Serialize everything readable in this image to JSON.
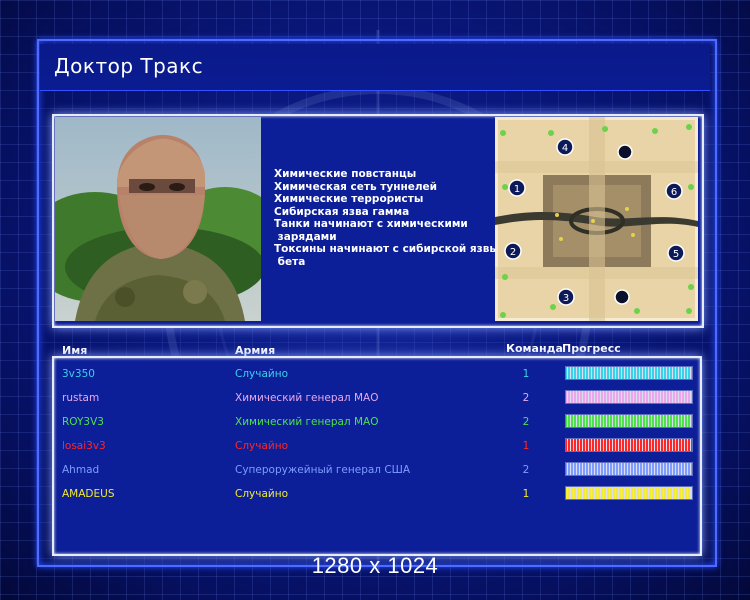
{
  "title": "Доктор Тракс",
  "description_lines": [
    "Химические повстанцы",
    "Химическая сеть туннелей",
    "Химические террористы",
    "Сибирская язва гамма",
    "Танки начинают с химическими",
    " зарядами",
    "Токсины начинают с сибирской язвы",
    " бета"
  ],
  "columns": {
    "player": "Имя игрока",
    "army": "Армия",
    "team": "Команда",
    "progress": "Прогресс"
  },
  "players": [
    {
      "name": "3v350",
      "army": "Случайно",
      "team": "1",
      "color": "#3ad2e8",
      "progress": 1.0
    },
    {
      "name": "rustam",
      "army": "Химический генерал МАО",
      "team": "2",
      "color": "#e8a8ea",
      "progress": 1.0
    },
    {
      "name": "ROY3V3",
      "army": "Химический генерал МАО",
      "team": "2",
      "color": "#4ee24a",
      "progress": 1.0
    },
    {
      "name": "losai3v3",
      "army": "Случайно",
      "team": "1",
      "color": "#ff2626",
      "progress": 1.0
    },
    {
      "name": "Ahmad",
      "army": "Супероружейный генерал США",
      "team": "2",
      "color": "#7f9cff",
      "progress": 1.0
    },
    {
      "name": "AMADEUS",
      "army": "Случайно",
      "team": "1",
      "color": "#f2ea34",
      "progress": 1.0
    }
  ],
  "map_start_labels": [
    "1",
    "2",
    "3",
    "4",
    "5",
    "6"
  ],
  "resolution": "1280 x 1024",
  "colors": {
    "frame": "#4d6bff",
    "panel": "#0c1f99",
    "map_sand": "#e5cf9f"
  }
}
